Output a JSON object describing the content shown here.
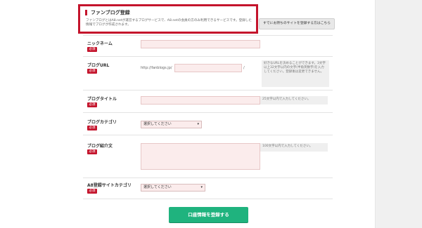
{
  "notice": {
    "title": "ファンブログ登録",
    "description": "ファンブログとはA8.netが運営するブログサービスで、A8.netの会員の方のみ利用できるサービスです。登録した情報でブログが作成されます。"
  },
  "already_button": "すでにお持ちのサイトを登録する方はこちら",
  "required_badge": "必須",
  "fields": {
    "nickname": {
      "label": "ニックネーム"
    },
    "blog_url": {
      "label": "ブログURL",
      "prefix": "http://fanblogs.jp/",
      "suffix": "/",
      "hint": "好きなURLを決めることができます。3文字以上32文字以内の文字(半角英数字)を入力してください。登録後は変更できません。"
    },
    "blog_title": {
      "label": "ブログタイトル",
      "hint": "25文字以内で入力してください。"
    },
    "blog_category": {
      "label": "ブログカテゴリ",
      "selected": "選択してください"
    },
    "blog_intro": {
      "label": "ブログ紹介文",
      "hint": "100文字以内で入力してください。"
    },
    "a8_category": {
      "label": "A8登録サイトカテゴリ",
      "selected": "選択してください"
    }
  },
  "submit": "口座情報を登録する",
  "colors": {
    "accent": "#c4142c",
    "submit": "#1fb37e",
    "input_bg": "#fbecec"
  }
}
